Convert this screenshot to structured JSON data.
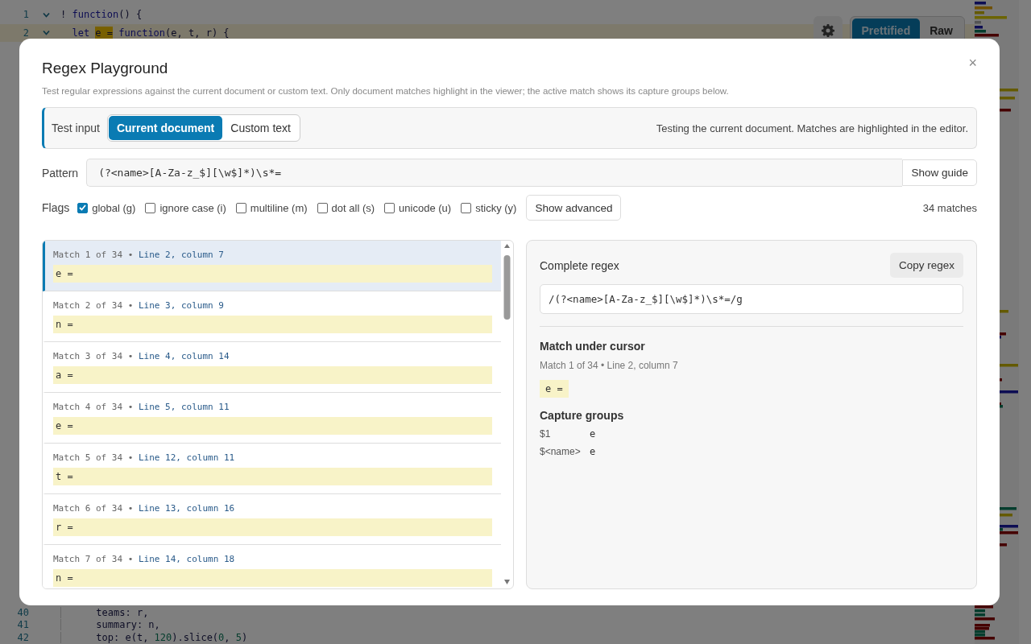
{
  "editor": {
    "lines_top": [
      {
        "number": "1",
        "fold": true,
        "current": false,
        "code": [
          {
            "kind": "plain",
            "text": "! "
          },
          {
            "kind": "keyword",
            "text": "function"
          },
          {
            "kind": "plain",
            "text": "() {"
          }
        ]
      },
      {
        "number": "2",
        "fold": true,
        "current": true,
        "code": [
          {
            "kind": "keyword",
            "text": "  let "
          },
          {
            "kind": "match",
            "text": "e ="
          },
          {
            "kind": "keyword",
            "text": " function"
          },
          {
            "kind": "plain",
            "text": "(e, t, r) {"
          }
        ]
      }
    ],
    "lines_bottom": [
      {
        "number": "40",
        "fold": false,
        "current": false,
        "code": [
          {
            "kind": "plain",
            "text": "      teams: r,"
          }
        ]
      },
      {
        "number": "41",
        "fold": false,
        "current": false,
        "code": [
          {
            "kind": "plain",
            "text": "      summary: n,"
          }
        ]
      },
      {
        "number": "42",
        "fold": false,
        "current": false,
        "code": [
          {
            "kind": "plain",
            "text": "      top: e(t, "
          },
          {
            "kind": "number",
            "text": "120"
          },
          {
            "kind": "plain",
            "text": ").slice("
          },
          {
            "kind": "number",
            "text": "0"
          },
          {
            "kind": "plain",
            "text": ", "
          },
          {
            "kind": "number",
            "text": "5"
          },
          {
            "kind": "plain",
            "text": ")"
          }
        ]
      }
    ]
  },
  "toolbar": {
    "view_modes": [
      {
        "label": "Prettified",
        "selected": true
      },
      {
        "label": "Raw",
        "selected": false
      }
    ]
  },
  "dialog": {
    "title": "Regex Playground",
    "close": "×",
    "subtitle": "Test regular expressions against the current document or custom text. Only document matches highlight in the viewer; the active match shows its capture groups below.",
    "test_input": {
      "label": "Test input",
      "options": [
        {
          "label": "Current document",
          "selected": true
        },
        {
          "label": "Custom text",
          "selected": false
        }
      ],
      "note": "Testing the current document. Matches are highlighted in the editor."
    },
    "pattern": {
      "label": "Pattern",
      "value": "(?<name>[A-Za-z_$][\\w$]*)\\s*=",
      "guide_button": "Show guide"
    },
    "flags": {
      "label": "Flags",
      "items": [
        {
          "label": "global (g)",
          "checked": true
        },
        {
          "label": "ignore case (i)",
          "checked": false
        },
        {
          "label": "multiline (m)",
          "checked": false
        },
        {
          "label": "dot all (s)",
          "checked": false
        },
        {
          "label": "unicode (u)",
          "checked": false
        },
        {
          "label": "sticky (y)",
          "checked": false
        }
      ],
      "advanced_button": "Show advanced",
      "count": "34 matches"
    },
    "matches": [
      {
        "heading": "Match 1 of 34 •",
        "location": "Line 2, column 7",
        "text": "e =",
        "selected": true
      },
      {
        "heading": "Match 2 of 34 •",
        "location": "Line 3, column 9",
        "text": "n =",
        "selected": false
      },
      {
        "heading": "Match 3 of 34 •",
        "location": "Line 4, column 14",
        "text": "a =",
        "selected": false
      },
      {
        "heading": "Match 4 of 34 •",
        "location": "Line 5, column 11",
        "text": "e =",
        "selected": false
      },
      {
        "heading": "Match 5 of 34 •",
        "location": "Line 12, column 11",
        "text": "t =",
        "selected": false
      },
      {
        "heading": "Match 6 of 34 •",
        "location": "Line 13, column 16",
        "text": "r =",
        "selected": false
      },
      {
        "heading": "Match 7 of 34 •",
        "location": "Line 14, column 18",
        "text": "n =",
        "selected": false
      }
    ],
    "detail": {
      "title": "Complete regex",
      "copy_button": "Copy regex",
      "regex": "/(?<name>[A-Za-z_$][\\w$]*)\\s*=/g",
      "cursor_title": "Match under cursor",
      "cursor_meta": "Match 1 of 34 • Line 2, column 7",
      "cursor_text": "e =",
      "groups_title": "Capture groups",
      "groups": [
        {
          "name": "$1",
          "value": "e"
        },
        {
          "name": "$<name>",
          "value": "e"
        }
      ]
    }
  }
}
